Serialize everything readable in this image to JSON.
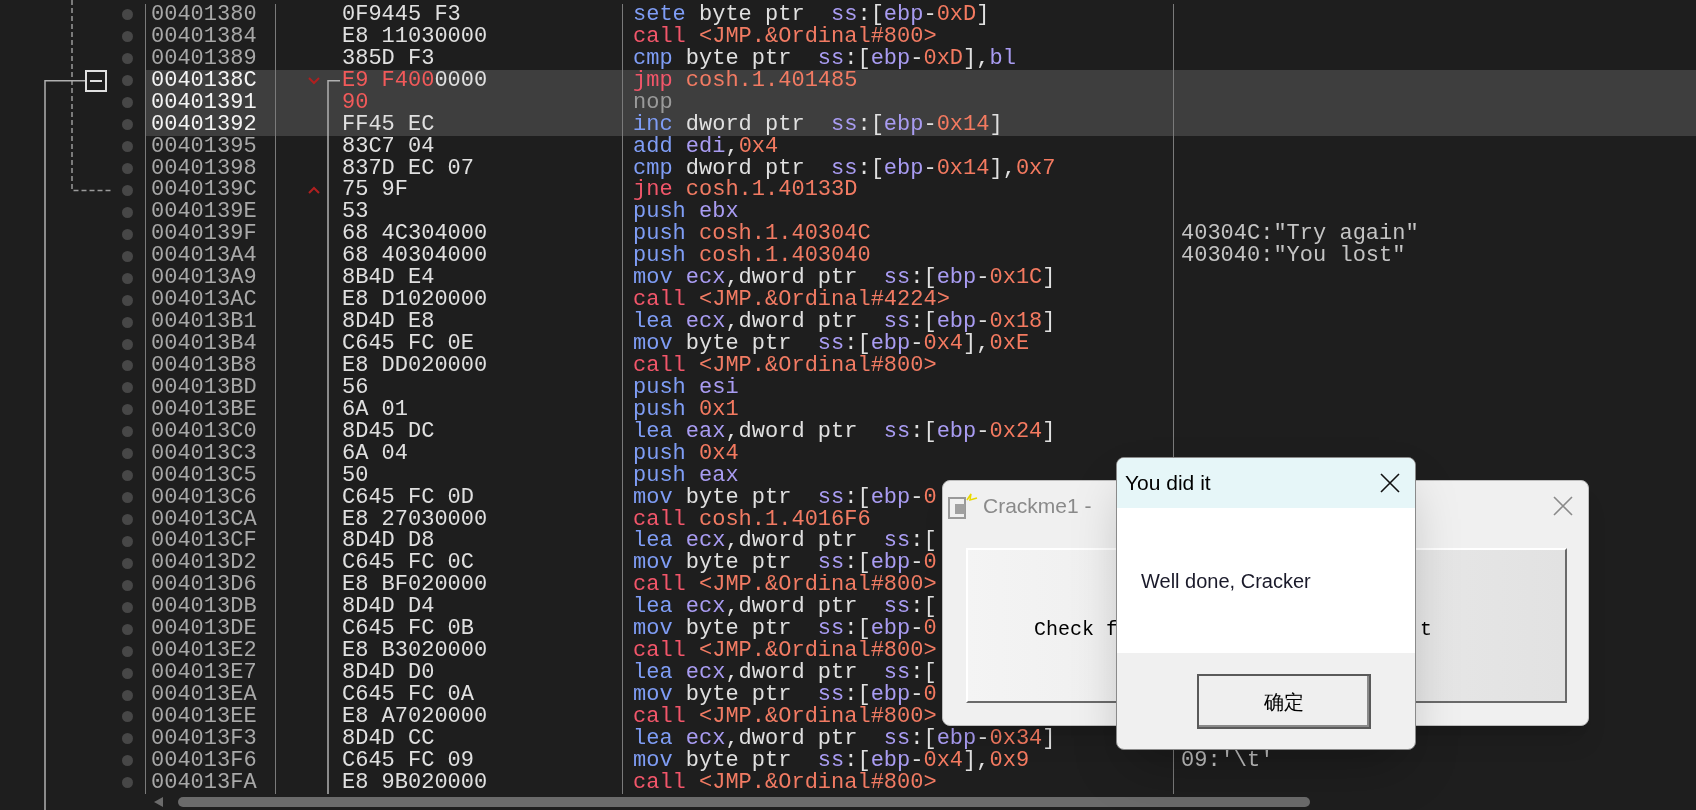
{
  "disassembly": {
    "rows": [
      {
        "kind": "plain",
        "address": "00401380",
        "selected": false,
        "bytes": [
          {
            "text": "0F9445 F3",
            "patched": false
          }
        ],
        "instruction": [
          {
            "text": "sete",
            "kind": "op"
          },
          {
            "text": " byte ptr  ",
            "kind": "text"
          },
          {
            "text": "ss",
            "kind": "reg"
          },
          {
            "text": ":[",
            "kind": "text"
          },
          {
            "text": "ebp",
            "kind": "reg"
          },
          {
            "text": "-",
            "kind": "text"
          },
          {
            "text": "0xD",
            "kind": "num"
          },
          {
            "text": "]",
            "kind": "text"
          }
        ]
      },
      {
        "kind": "plain",
        "address": "00401384",
        "selected": false,
        "bytes": [
          {
            "text": "E8 11030000",
            "patched": false
          }
        ],
        "instruction": [
          {
            "text": "call ",
            "kind": "branch"
          },
          {
            "text": "<JMP.&Ordinal#800>",
            "kind": "addr"
          }
        ]
      },
      {
        "kind": "plain",
        "address": "00401389",
        "selected": false,
        "bytes": [
          {
            "text": "385D F3",
            "patched": false
          }
        ],
        "instruction": [
          {
            "text": "cmp",
            "kind": "op"
          },
          {
            "text": " byte ptr  ",
            "kind": "text"
          },
          {
            "text": "ss",
            "kind": "reg"
          },
          {
            "text": ":[",
            "kind": "text"
          },
          {
            "text": "ebp",
            "kind": "reg"
          },
          {
            "text": "-",
            "kind": "text"
          },
          {
            "text": "0xD",
            "kind": "num"
          },
          {
            "text": "],",
            "kind": "text"
          },
          {
            "text": "bl",
            "kind": "reg"
          }
        ]
      },
      {
        "kind": "jump_down",
        "address": "0040138C",
        "selected": true,
        "bytes": [
          {
            "text": "E9 F400",
            "patched": true
          },
          {
            "text": "0000",
            "patched": false
          }
        ],
        "instruction": [
          {
            "text": "jmp ",
            "kind": "branch"
          },
          {
            "text": "cosh.1.401485",
            "kind": "addr"
          }
        ]
      },
      {
        "kind": "plain",
        "address": "00401391",
        "selected": true,
        "bytes": [
          {
            "text": "90",
            "patched": true
          }
        ],
        "instruction": [
          {
            "text": "nop",
            "kind": "nop"
          }
        ]
      },
      {
        "kind": "plain",
        "address": "00401392",
        "selected": true,
        "bytes": [
          {
            "text": "FF45 EC",
            "patched": false
          }
        ],
        "instruction": [
          {
            "text": "inc",
            "kind": "op"
          },
          {
            "text": " dword ptr  ",
            "kind": "text"
          },
          {
            "text": "ss",
            "kind": "reg"
          },
          {
            "text": ":[",
            "kind": "text"
          },
          {
            "text": "ebp",
            "kind": "reg"
          },
          {
            "text": "-",
            "kind": "text"
          },
          {
            "text": "0x14",
            "kind": "num"
          },
          {
            "text": "]",
            "kind": "text"
          }
        ]
      },
      {
        "kind": "plain",
        "address": "00401395",
        "selected": false,
        "bytes": [
          {
            "text": "83C7 04",
            "patched": false
          }
        ],
        "instruction": [
          {
            "text": "add ",
            "kind": "op"
          },
          {
            "text": "edi",
            "kind": "reg"
          },
          {
            "text": ",",
            "kind": "text"
          },
          {
            "text": "0x4",
            "kind": "num"
          }
        ]
      },
      {
        "kind": "plain",
        "address": "00401398",
        "selected": false,
        "bytes": [
          {
            "text": "837D EC 07",
            "patched": false
          }
        ],
        "instruction": [
          {
            "text": "cmp",
            "kind": "op"
          },
          {
            "text": " dword ptr  ",
            "kind": "text"
          },
          {
            "text": "ss",
            "kind": "reg"
          },
          {
            "text": ":[",
            "kind": "text"
          },
          {
            "text": "ebp",
            "kind": "reg"
          },
          {
            "text": "-",
            "kind": "text"
          },
          {
            "text": "0x14",
            "kind": "num"
          },
          {
            "text": "],",
            "kind": "text"
          },
          {
            "text": "0x7",
            "kind": "num"
          }
        ]
      },
      {
        "kind": "jump_up",
        "address": "0040139C",
        "selected": false,
        "bytes": [
          {
            "text": "75 9F",
            "patched": false
          }
        ],
        "instruction": [
          {
            "text": "jne ",
            "kind": "branch"
          },
          {
            "text": "cosh.1.40133D",
            "kind": "addr"
          }
        ]
      },
      {
        "kind": "plain",
        "address": "0040139E",
        "selected": false,
        "bytes": [
          {
            "text": "53",
            "patched": false
          }
        ],
        "instruction": [
          {
            "text": "push ",
            "kind": "op"
          },
          {
            "text": "ebx",
            "kind": "reg"
          }
        ]
      },
      {
        "kind": "plain",
        "address": "0040139F",
        "selected": false,
        "bytes": [
          {
            "text": "68 4C304000",
            "patched": false
          }
        ],
        "instruction": [
          {
            "text": "push ",
            "kind": "op"
          },
          {
            "text": "cosh.1.40304C",
            "kind": "addr"
          }
        ],
        "comment": "40304C:\"Try again\""
      },
      {
        "kind": "plain",
        "address": "004013A4",
        "selected": false,
        "bytes": [
          {
            "text": "68 40304000",
            "patched": false
          }
        ],
        "instruction": [
          {
            "text": "push ",
            "kind": "op"
          },
          {
            "text": "cosh.1.403040",
            "kind": "addr"
          }
        ],
        "comment": "403040:\"You lost\""
      },
      {
        "kind": "plain",
        "address": "004013A9",
        "selected": false,
        "bytes": [
          {
            "text": "8B4D E4",
            "patched": false
          }
        ],
        "instruction": [
          {
            "text": "mov ",
            "kind": "op"
          },
          {
            "text": "ecx",
            "kind": "reg"
          },
          {
            "text": ",dword ptr  ",
            "kind": "text"
          },
          {
            "text": "ss",
            "kind": "reg"
          },
          {
            "text": ":[",
            "kind": "text"
          },
          {
            "text": "ebp",
            "kind": "reg"
          },
          {
            "text": "-",
            "kind": "text"
          },
          {
            "text": "0x1C",
            "kind": "num"
          },
          {
            "text": "]",
            "kind": "text"
          }
        ]
      },
      {
        "kind": "plain",
        "address": "004013AC",
        "selected": false,
        "bytes": [
          {
            "text": "E8 D1020000",
            "patched": false
          }
        ],
        "instruction": [
          {
            "text": "call ",
            "kind": "branch"
          },
          {
            "text": "<JMP.&Ordinal#4224>",
            "kind": "addr"
          }
        ]
      },
      {
        "kind": "plain",
        "address": "004013B1",
        "selected": false,
        "bytes": [
          {
            "text": "8D4D E8",
            "patched": false
          }
        ],
        "instruction": [
          {
            "text": "lea ",
            "kind": "op"
          },
          {
            "text": "ecx",
            "kind": "reg"
          },
          {
            "text": ",dword ptr  ",
            "kind": "text"
          },
          {
            "text": "ss",
            "kind": "reg"
          },
          {
            "text": ":[",
            "kind": "text"
          },
          {
            "text": "ebp",
            "kind": "reg"
          },
          {
            "text": "-",
            "kind": "text"
          },
          {
            "text": "0x18",
            "kind": "num"
          },
          {
            "text": "]",
            "kind": "text"
          }
        ]
      },
      {
        "kind": "plain",
        "address": "004013B4",
        "selected": false,
        "bytes": [
          {
            "text": "C645 FC 0E",
            "patched": false
          }
        ],
        "instruction": [
          {
            "text": "mov",
            "kind": "op"
          },
          {
            "text": " byte ptr  ",
            "kind": "text"
          },
          {
            "text": "ss",
            "kind": "reg"
          },
          {
            "text": ":[",
            "kind": "text"
          },
          {
            "text": "ebp",
            "kind": "reg"
          },
          {
            "text": "-",
            "kind": "text"
          },
          {
            "text": "0x4",
            "kind": "num"
          },
          {
            "text": "],",
            "kind": "text"
          },
          {
            "text": "0xE",
            "kind": "num"
          }
        ]
      },
      {
        "kind": "plain",
        "address": "004013B8",
        "selected": false,
        "bytes": [
          {
            "text": "E8 DD020000",
            "patched": false
          }
        ],
        "instruction": [
          {
            "text": "call ",
            "kind": "branch"
          },
          {
            "text": "<JMP.&Ordinal#800>",
            "kind": "addr"
          }
        ]
      },
      {
        "kind": "plain",
        "address": "004013BD",
        "selected": false,
        "bytes": [
          {
            "text": "56",
            "patched": false
          }
        ],
        "instruction": [
          {
            "text": "push ",
            "kind": "op"
          },
          {
            "text": "esi",
            "kind": "reg"
          }
        ]
      },
      {
        "kind": "plain",
        "address": "004013BE",
        "selected": false,
        "bytes": [
          {
            "text": "6A 01",
            "patched": false
          }
        ],
        "instruction": [
          {
            "text": "push ",
            "kind": "op"
          },
          {
            "text": "0x1",
            "kind": "num"
          }
        ]
      },
      {
        "kind": "plain",
        "address": "004013C0",
        "selected": false,
        "bytes": [
          {
            "text": "8D45 DC",
            "patched": false
          }
        ],
        "instruction": [
          {
            "text": "lea ",
            "kind": "op"
          },
          {
            "text": "eax",
            "kind": "reg"
          },
          {
            "text": ",dword ptr  ",
            "kind": "text"
          },
          {
            "text": "ss",
            "kind": "reg"
          },
          {
            "text": ":[",
            "kind": "text"
          },
          {
            "text": "ebp",
            "kind": "reg"
          },
          {
            "text": "-",
            "kind": "text"
          },
          {
            "text": "0x24",
            "kind": "num"
          },
          {
            "text": "]",
            "kind": "text"
          }
        ]
      },
      {
        "kind": "plain",
        "address": "004013C3",
        "selected": false,
        "bytes": [
          {
            "text": "6A 04",
            "patched": false
          }
        ],
        "instruction": [
          {
            "text": "push ",
            "kind": "op"
          },
          {
            "text": "0x4",
            "kind": "num"
          }
        ]
      },
      {
        "kind": "plain",
        "address": "004013C5",
        "selected": false,
        "bytes": [
          {
            "text": "50",
            "patched": false
          }
        ],
        "instruction": [
          {
            "text": "push ",
            "kind": "op"
          },
          {
            "text": "eax",
            "kind": "reg"
          }
        ]
      },
      {
        "kind": "plain",
        "address": "004013C6",
        "selected": false,
        "bytes": [
          {
            "text": "C645 FC 0D",
            "patched": false
          }
        ],
        "instruction": [
          {
            "text": "mov",
            "kind": "op"
          },
          {
            "text": " byte ptr  ",
            "kind": "text"
          },
          {
            "text": "ss",
            "kind": "reg"
          },
          {
            "text": ":[",
            "kind": "text"
          },
          {
            "text": "ebp",
            "kind": "reg"
          },
          {
            "text": "-",
            "kind": "text"
          },
          {
            "text": "0",
            "kind": "num"
          }
        ]
      },
      {
        "kind": "plain",
        "address": "004013CA",
        "selected": false,
        "bytes": [
          {
            "text": "E8 27030000",
            "patched": false
          }
        ],
        "instruction": [
          {
            "text": "call ",
            "kind": "branch"
          },
          {
            "text": "cosh.1.4016F6",
            "kind": "addr"
          }
        ]
      },
      {
        "kind": "plain",
        "address": "004013CF",
        "selected": false,
        "bytes": [
          {
            "text": "8D4D D8",
            "patched": false
          }
        ],
        "instruction": [
          {
            "text": "lea ",
            "kind": "op"
          },
          {
            "text": "ecx",
            "kind": "reg"
          },
          {
            "text": ",dword ptr  ",
            "kind": "text"
          },
          {
            "text": "ss",
            "kind": "reg"
          },
          {
            "text": ":[",
            "kind": "text"
          }
        ]
      },
      {
        "kind": "plain",
        "address": "004013D2",
        "selected": false,
        "bytes": [
          {
            "text": "C645 FC 0C",
            "patched": false
          }
        ],
        "instruction": [
          {
            "text": "mov",
            "kind": "op"
          },
          {
            "text": " byte ptr  ",
            "kind": "text"
          },
          {
            "text": "ss",
            "kind": "reg"
          },
          {
            "text": ":[",
            "kind": "text"
          },
          {
            "text": "ebp",
            "kind": "reg"
          },
          {
            "text": "-",
            "kind": "text"
          },
          {
            "text": "0",
            "kind": "num"
          }
        ]
      },
      {
        "kind": "plain",
        "address": "004013D6",
        "selected": false,
        "bytes": [
          {
            "text": "E8 BF020000",
            "patched": false
          }
        ],
        "instruction": [
          {
            "text": "call ",
            "kind": "branch"
          },
          {
            "text": "<JMP.&Ordinal#800>",
            "kind": "addr"
          }
        ]
      },
      {
        "kind": "plain",
        "address": "004013DB",
        "selected": false,
        "bytes": [
          {
            "text": "8D4D D4",
            "patched": false
          }
        ],
        "instruction": [
          {
            "text": "lea ",
            "kind": "op"
          },
          {
            "text": "ecx",
            "kind": "reg"
          },
          {
            "text": ",dword ptr  ",
            "kind": "text"
          },
          {
            "text": "ss",
            "kind": "reg"
          },
          {
            "text": ":[",
            "kind": "text"
          }
        ]
      },
      {
        "kind": "plain",
        "address": "004013DE",
        "selected": false,
        "bytes": [
          {
            "text": "C645 FC 0B",
            "patched": false
          }
        ],
        "instruction": [
          {
            "text": "mov",
            "kind": "op"
          },
          {
            "text": " byte ptr  ",
            "kind": "text"
          },
          {
            "text": "ss",
            "kind": "reg"
          },
          {
            "text": ":[",
            "kind": "text"
          },
          {
            "text": "ebp",
            "kind": "reg"
          },
          {
            "text": "-",
            "kind": "text"
          },
          {
            "text": "0",
            "kind": "num"
          }
        ]
      },
      {
        "kind": "plain",
        "address": "004013E2",
        "selected": false,
        "bytes": [
          {
            "text": "E8 B3020000",
            "patched": false
          }
        ],
        "instruction": [
          {
            "text": "call ",
            "kind": "branch"
          },
          {
            "text": "<JMP.&Ordinal#800>",
            "kind": "addr"
          }
        ]
      },
      {
        "kind": "plain",
        "address": "004013E7",
        "selected": false,
        "bytes": [
          {
            "text": "8D4D D0",
            "patched": false
          }
        ],
        "instruction": [
          {
            "text": "lea ",
            "kind": "op"
          },
          {
            "text": "ecx",
            "kind": "reg"
          },
          {
            "text": ",dword ptr  ",
            "kind": "text"
          },
          {
            "text": "ss",
            "kind": "reg"
          },
          {
            "text": ":[",
            "kind": "text"
          }
        ]
      },
      {
        "kind": "plain",
        "address": "004013EA",
        "selected": false,
        "bytes": [
          {
            "text": "C645 FC 0A",
            "patched": false
          }
        ],
        "instruction": [
          {
            "text": "mov",
            "kind": "op"
          },
          {
            "text": " byte ptr  ",
            "kind": "text"
          },
          {
            "text": "ss",
            "kind": "reg"
          },
          {
            "text": ":[",
            "kind": "text"
          },
          {
            "text": "ebp",
            "kind": "reg"
          },
          {
            "text": "-",
            "kind": "text"
          },
          {
            "text": "0",
            "kind": "num"
          }
        ]
      },
      {
        "kind": "plain",
        "address": "004013EE",
        "selected": false,
        "bytes": [
          {
            "text": "E8 A7020000",
            "patched": false
          }
        ],
        "instruction": [
          {
            "text": "call ",
            "kind": "branch"
          },
          {
            "text": "<JMP.&Ordinal#800>",
            "kind": "addr"
          }
        ]
      },
      {
        "kind": "plain",
        "address": "004013F3",
        "selected": false,
        "bytes": [
          {
            "text": "8D4D CC",
            "patched": false
          }
        ],
        "instruction": [
          {
            "text": "lea ",
            "kind": "op"
          },
          {
            "text": "ecx",
            "kind": "reg"
          },
          {
            "text": ",dword ptr  ",
            "kind": "text"
          },
          {
            "text": "ss",
            "kind": "reg"
          },
          {
            "text": ":[",
            "kind": "text"
          },
          {
            "text": "ebp",
            "kind": "reg"
          },
          {
            "text": "-",
            "kind": "text"
          },
          {
            "text": "0x34",
            "kind": "num"
          },
          {
            "text": "]",
            "kind": "text"
          }
        ]
      },
      {
        "kind": "plain",
        "address": "004013F6",
        "selected": false,
        "bytes": [
          {
            "text": "C645 FC 09",
            "patched": false
          }
        ],
        "instruction": [
          {
            "text": "mov",
            "kind": "op"
          },
          {
            "text": " byte ptr  ",
            "kind": "text"
          },
          {
            "text": "ss",
            "kind": "reg"
          },
          {
            "text": ":[",
            "kind": "text"
          },
          {
            "text": "ebp",
            "kind": "reg"
          },
          {
            "text": "-",
            "kind": "text"
          },
          {
            "text": "0x4",
            "kind": "num"
          },
          {
            "text": "],",
            "kind": "text"
          },
          {
            "text": "0x9",
            "kind": "num"
          }
        ],
        "comment": "09:'\\t'"
      },
      {
        "kind": "plain",
        "address": "004013FA",
        "selected": false,
        "bytes": [
          {
            "text": "E8 9B020000",
            "patched": false
          }
        ],
        "instruction": [
          {
            "text": "call ",
            "kind": "branch"
          },
          {
            "text": "<JMP.&Ordinal#800>",
            "kind": "addr"
          }
        ]
      }
    ]
  },
  "background_window": {
    "title": "Crackme1 -",
    "button_text_parts": [
      "Check f",
      "t"
    ]
  },
  "message_box": {
    "title": "You did it",
    "message": "Well done, Cracker",
    "button": "确定"
  }
}
